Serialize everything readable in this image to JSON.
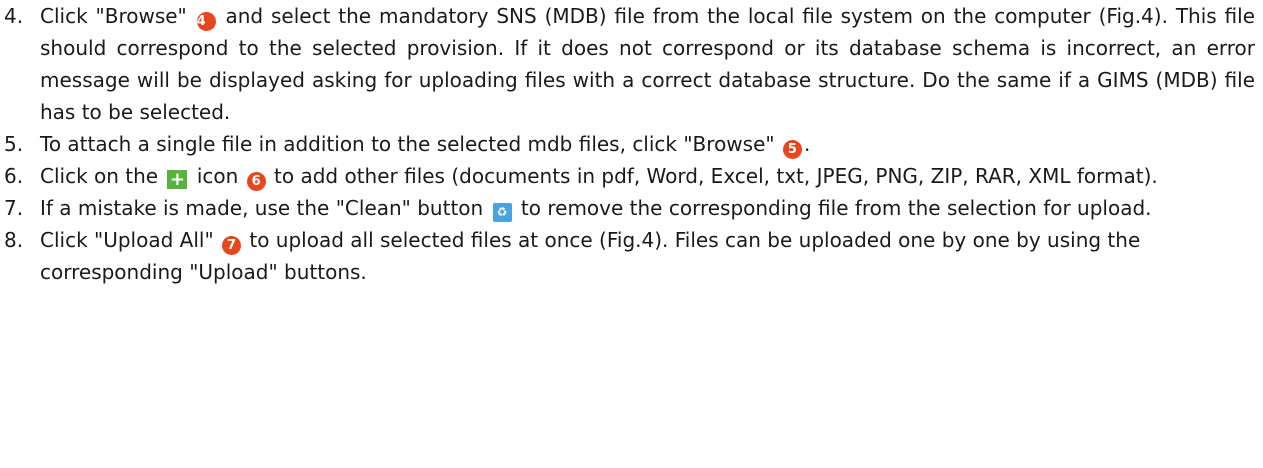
{
  "colors": {
    "circled_number_fill": "#e8461c",
    "add_icon_fill": "#57b33e",
    "clean_icon_fill": "#4aa3e0",
    "text": "#1a1a1a"
  },
  "icons": {
    "add": "plus-icon",
    "clean": "recycle-icon"
  },
  "steps": [
    {
      "number": "4.",
      "parts": [
        "Click \"Browse\"",
        "4",
        "and select the mandatory SNS (MDB) file from the local file system on the computer (Fig.4). This file should correspond to the selected provision. If it does not correspond or its database schema is incorrect, an error message will be displayed asking for uploading files with a correct database structure. Do the same if a GIMS (MDB) file has to be selected."
      ]
    },
    {
      "number": "5.",
      "parts": [
        "To attach a single file in addition to the selected mdb files, click \"Browse\"",
        "5",
        "."
      ]
    },
    {
      "number": "6.",
      "parts": [
        "Click on the",
        "icon",
        "6",
        "to add other files (documents in pdf, Word, Excel, txt, JPEG, PNG, ZIP, RAR, XML format)."
      ]
    },
    {
      "number": "7.",
      "parts": [
        "If a mistake is made, use the \"Clean\" button",
        "to remove the corresponding file from the selection for upload."
      ]
    },
    {
      "number": "8.",
      "parts": [
        "Click \"Upload All\"",
        "7",
        "to upload all selected files at once (Fig.4). Files can be uploaded one by one by using the corresponding \"Upload\" buttons."
      ]
    }
  ]
}
